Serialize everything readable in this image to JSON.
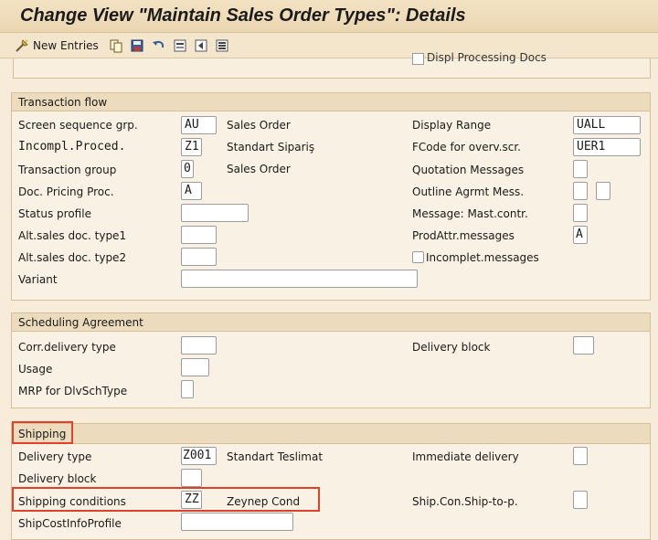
{
  "window": {
    "title": "Change View \"Maintain Sales Order Types\": Details"
  },
  "toolbar": {
    "new_entries_label": "New Entries",
    "icons": [
      "new-entries-icon",
      "copy-icon",
      "save-icon",
      "undo-icon",
      "first-entry-icon",
      "previous-entry-icon",
      "next-entry-icon"
    ]
  },
  "partial_row": {
    "checkbox_label": "Displ Processing Docs"
  },
  "transaction_flow": {
    "title": "Transaction flow",
    "screen_sequence_grp": {
      "label": "Screen sequence grp.",
      "value": "AU",
      "description": "Sales Order"
    },
    "incompl_proced": {
      "label": "Incompl.Proced.",
      "value": "Z1",
      "description": "Standart Sipariş"
    },
    "transaction_group": {
      "label": "Transaction group",
      "value": "0",
      "description": "Sales Order"
    },
    "doc_pricing_proc": {
      "label": "Doc. Pricing Proc.",
      "value": "A"
    },
    "status_profile": {
      "label": "Status profile",
      "value": ""
    },
    "alt_sales_doc_type1": {
      "label": "Alt.sales doc. type1",
      "value": ""
    },
    "alt_sales_doc_type2": {
      "label": "Alt.sales doc. type2",
      "value": ""
    },
    "variant": {
      "label": "Variant",
      "value": ""
    },
    "display_range": {
      "label": "Display Range",
      "value": "UALL"
    },
    "fcode_overv": {
      "label": "FCode for overv.scr.",
      "value": "UER1"
    },
    "quotation_messages": {
      "label": "Quotation Messages",
      "value": ""
    },
    "outline_agrmt_mess": {
      "label": "Outline Agrmt Mess.",
      "value": "",
      "value2": ""
    },
    "message_mast_contr": {
      "label": "Message: Mast.contr.",
      "value": ""
    },
    "prodattr_messages": {
      "label": "ProdAttr.messages",
      "value": "A"
    },
    "incomplet_messages": {
      "label": "Incomplet.messages",
      "checked": false
    }
  },
  "scheduling_agreement": {
    "title": "Scheduling Agreement",
    "corr_delivery_type": {
      "label": "Corr.delivery type",
      "value": ""
    },
    "usage": {
      "label": "Usage",
      "value": ""
    },
    "mrp_dlvschtype": {
      "label": "MRP for DlvSchType",
      "value": ""
    },
    "delivery_block": {
      "label": "Delivery block",
      "value": ""
    }
  },
  "shipping": {
    "title": "Shipping",
    "delivery_type": {
      "label": "Delivery type",
      "value": "Z001",
      "description": "Standart Teslimat"
    },
    "delivery_block": {
      "label": "Delivery block",
      "value": ""
    },
    "shipping_conditions": {
      "label": "Shipping conditions",
      "value": "ZZ",
      "description": "Zeynep Cond"
    },
    "shipcostinfoprofile": {
      "label": "ShipCostInfoProfile",
      "value": ""
    },
    "immediate_delivery": {
      "label": "Immediate delivery",
      "value": ""
    },
    "ship_con_ship_to_p": {
      "label": "Ship.Con.Ship-to-p.",
      "value": ""
    }
  },
  "colors": {
    "highlight": "#e0412b",
    "background": "#f6ecd9",
    "group_header": "#ecdcbd"
  }
}
